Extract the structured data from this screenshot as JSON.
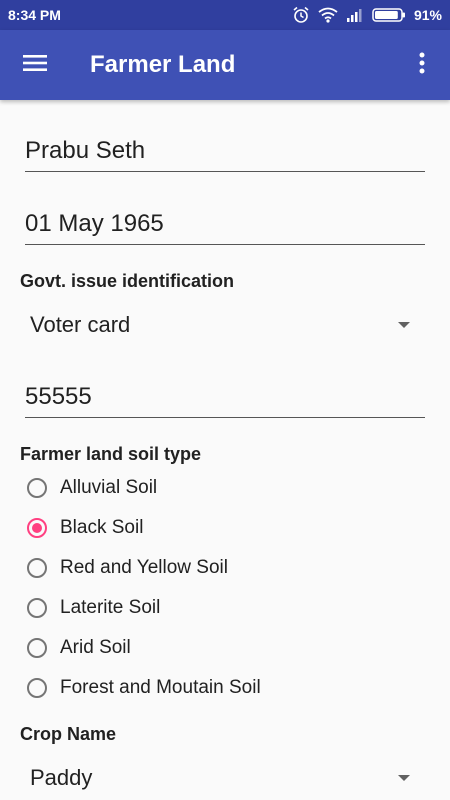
{
  "status_bar": {
    "time": "8:34 PM",
    "battery_percent": "91%",
    "battery_level": 0.91,
    "icons": [
      "alarm-icon",
      "wifi-icon",
      "signal-icon",
      "battery-icon"
    ]
  },
  "app_bar": {
    "title": "Farmer Land",
    "menu_icon": "hamburger-menu-icon",
    "overflow_icon": "more-vert-icon",
    "color": "#3f51b5",
    "status_color": "#303f9f"
  },
  "form": {
    "name": {
      "value": "Prabu Seth"
    },
    "dob": {
      "value": "01 May 1965"
    },
    "govt_id_label": "Govt. issue identification",
    "govt_id_type": {
      "selected": "Voter card"
    },
    "govt_id_number": {
      "value": "55555"
    },
    "soil_label": "Farmer land soil type",
    "soil_options": [
      {
        "label": "Alluvial Soil",
        "checked": false
      },
      {
        "label": "Black Soil",
        "checked": true
      },
      {
        "label": "Red and Yellow Soil",
        "checked": false
      },
      {
        "label": "Laterite Soil",
        "checked": false
      },
      {
        "label": "Arid Soil",
        "checked": false
      },
      {
        "label": "Forest and Moutain Soil",
        "checked": false
      }
    ],
    "crop_label": "Crop Name",
    "crop": {
      "selected": "Paddy"
    },
    "accent_color": "#ff4081"
  }
}
